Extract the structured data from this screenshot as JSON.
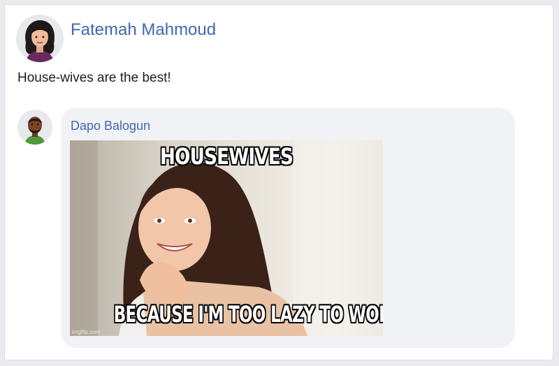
{
  "post": {
    "author": "Fatemah Mahmoud",
    "text": "House-wives are the best!"
  },
  "comment": {
    "author": "Dapo Balogun",
    "meme": {
      "top_text": "HOUSEWIVES",
      "bottom_text": "BECAUSE I'M TOO LAZY TO WORK",
      "watermark": "imgflip.com"
    }
  },
  "colors": {
    "link": "#4267b2",
    "bubble": "#f0f2f5",
    "page_bg": "#e9ebee"
  },
  "icons": {
    "post_avatar": "woman-avatar-icon",
    "comment_avatar": "man-avatar-icon"
  }
}
